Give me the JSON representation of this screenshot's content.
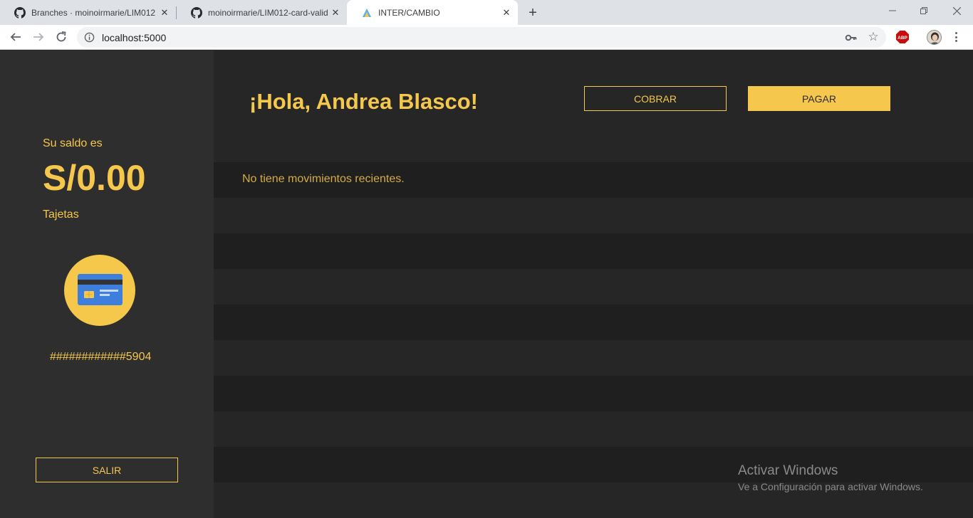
{
  "browser": {
    "tabs": [
      {
        "title": "Branches · moinoirmarie/LIM012",
        "icon": "github-icon"
      },
      {
        "title": "moinoirmarie/LIM012-card-valid",
        "icon": "github-icon"
      },
      {
        "title": "INTER/CAMBIO",
        "icon": "app-logo-icon"
      }
    ],
    "url": "localhost:5000",
    "extension_badge": "ABP"
  },
  "sidebar": {
    "balance_label": "Su saldo es",
    "balance_amount": "S/0.00",
    "cards_label": "Tajetas",
    "card_icon": "credit-card-icon",
    "card_number": "############5904",
    "logout_label": "SALIR"
  },
  "header": {
    "greeting": "¡Hola, Andrea Blasco!",
    "collect_label": "COBRAR",
    "pay_label": "PAGAR"
  },
  "movements": {
    "empty_message": "No tiene movimientos recientes."
  },
  "watermark": {
    "title": "Activar Windows",
    "subtitle": "Ve a Configuración para activar Windows."
  },
  "colors": {
    "accent": "#f5c74c",
    "sidebar_bg": "#2e2e2e",
    "main_bg": "#262626",
    "row_dark": "#1f1f1f"
  }
}
